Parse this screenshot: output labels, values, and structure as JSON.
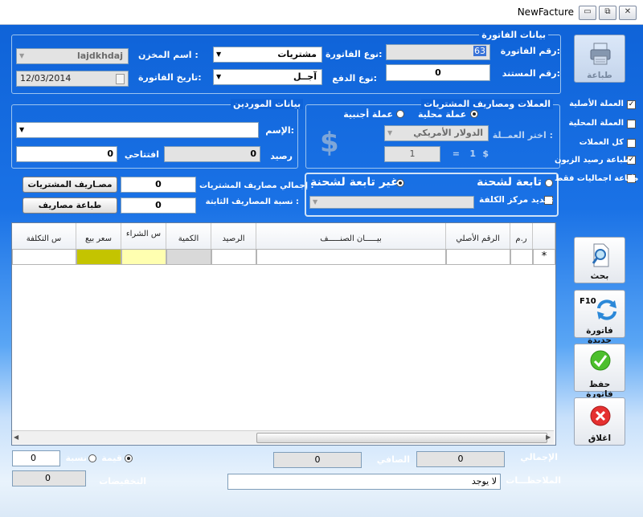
{
  "window": {
    "title": "NewFacture",
    "controls": {
      "minimize": "▭",
      "maximize": "⧉",
      "close": "✕"
    }
  },
  "invoice": {
    "group_title": "بيانات الفاتورة",
    "invoice_no_label": "رقم الفاتورة:",
    "invoice_no": "63",
    "invoice_type_label": "نوع الفاتورة:",
    "invoice_type": "مشتريات",
    "store_name_label": "اسم المخزن :",
    "store_name": "lajdkhdaj",
    "document_no_label": "رقم المستند:",
    "document_no": "0",
    "payment_type_label": "نوع الدفع:",
    "payment_type": "آجــل",
    "invoice_date_label": "تاريخ الفاتورة:",
    "invoice_date": "12/03/2014"
  },
  "suppliers": {
    "group_title": "بيانات الموردين",
    "name_label": "الإسم:",
    "name_value": "",
    "balance_label": "رصيد",
    "balance": "0",
    "opening_label": "افتتاحي",
    "opening": "0"
  },
  "currency": {
    "group_title": "العملات ومصاريف المشتريات",
    "local_label": "عملة محلية",
    "foreign_label": "عملة أجنبية",
    "choose_label": "اختر العمــلة :",
    "currency_value": "الدولار الأمريكي",
    "rate_dollar": "$",
    "rate_one": "1",
    "rate_eq": "=",
    "rate_value": "1",
    "big_symbol": "$"
  },
  "expenses": {
    "total_label": "إجمالي مصاريف المشتريات :",
    "total_value": "0",
    "purchases_expenses_button": "مصـاريف المشتريات",
    "fixed_ratio_label": "نسبة المصاريف الثابتة :",
    "fixed_ratio_value": "0",
    "print_expenses_button": "طباعة مصاريف"
  },
  "shipment": {
    "attached_label": "تابعة لشحنة",
    "not_attached_label": "غير تابعة لشحنة",
    "cost_center_label": "تحديد مركز الكلفة"
  },
  "side_options": [
    {
      "label": "العملة الأصلية",
      "checked": true
    },
    {
      "label": "العملة المحلية",
      "checked": false
    },
    {
      "label": "كل العملات",
      "checked": false
    },
    {
      "label": "طباعة رصيد الزبون",
      "checked": true
    },
    {
      "label": "طباعة اجماليات فقط",
      "checked": false
    }
  ],
  "side_buttons": {
    "print": "طباعة",
    "search": "بحث",
    "new_invoice": "فاتورة جديدة",
    "new_invoice_key": "F10",
    "save": "حفظ فاتورة",
    "close": "اغلاق"
  },
  "grid": {
    "columns": [
      "ر.م",
      "الرقم الأصلي",
      "بيـــــان الصنـــــف",
      "الرصيد",
      "الكمية",
      "س الشراء",
      "سعر بيع",
      "س التكلفة"
    ],
    "new_row_marker": "*",
    "colors": {
      "sale_price": "#c4c400",
      "purchase_price": "#ffffb0",
      "quantity": "#d9d9d9"
    }
  },
  "totals": {
    "total_label": "الإجمالي",
    "total_value": "0",
    "net_label": "الصافي",
    "net_value": "0",
    "notes_label": "الملاحظـــات",
    "notes_value": "لا يوجد",
    "discounts_label": "التخفيضات",
    "discounts_value": "0",
    "value_label": "قيمة",
    "ratio_label": "نسبة",
    "discount_input": "0"
  }
}
